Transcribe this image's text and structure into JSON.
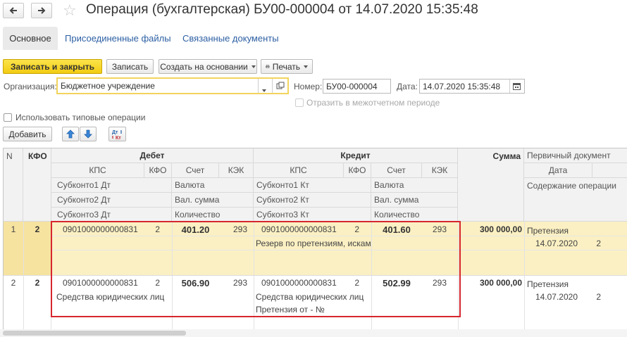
{
  "window": {
    "title": "Операция (бухгалтерская) БУ00-000004 от 14.07.2020 15:35:48"
  },
  "tabs": {
    "main": "Основное",
    "files": "Присоединенные файлы",
    "linked": "Связанные документы"
  },
  "toolbar": {
    "save_close": "Записать и закрыть",
    "save": "Записать",
    "create_based": "Создать на основании",
    "print": "Печать"
  },
  "form": {
    "org_label": "Организация:",
    "org_value": "Бюджетное учреждение",
    "number_label": "Номер:",
    "number_value": "БУ00-000004",
    "date_label": "Дата:",
    "date_value": "14.07.2020 15:35:48",
    "interperiod_label": "Отразить в межотчетном периоде",
    "typical_ops_label": "Использовать типовые операции",
    "add_button": "Добавить"
  },
  "table": {
    "headers": {
      "n": "N",
      "kfo": "КФО",
      "debit": "Дебет",
      "credit": "Кредит",
      "sum": "Сумма",
      "primary_doc": "Первичный документ",
      "kps": "КПС",
      "kfo_sub": "КФО",
      "account": "Счет",
      "kek": "КЭК",
      "date": "Дата",
      "sub1_dt": "Субконто1 Дт",
      "sub2_dt": "Субконто2 Дт",
      "sub3_dt": "Субконто3 Дт",
      "currency": "Валюта",
      "cur_sum": "Вал. сумма",
      "qty": "Количество",
      "sub1_kt": "Субконто1 Кт",
      "sub2_kt": "Субконто2 Кт",
      "sub3_kt": "Субконто3 Кт",
      "content": "Содержание операции"
    },
    "rows": [
      {
        "n": "1",
        "kfo": "2",
        "dt_kps": "0901000000000831",
        "dt_kfo": "2",
        "dt_account": "401.20",
        "dt_kek": "293",
        "dt_sub1": "",
        "dt_sub2": "",
        "kt_kps": "0901000000000831",
        "kt_kfo": "2",
        "kt_account": "401.60",
        "kt_kek": "293",
        "kt_sub1": "Резерв по претензиям, искам",
        "kt_sub2": "",
        "sum": "300 000,00",
        "doc_name": "Претензия",
        "doc_date": "14.07.2020",
        "doc_num": "2"
      },
      {
        "n": "2",
        "kfo": "2",
        "dt_kps": "0901000000000831",
        "dt_kfo": "2",
        "dt_account": "506.90",
        "dt_kek": "293",
        "dt_sub1": "Средства юридических лиц",
        "dt_sub2": "",
        "kt_kps": "0901000000000831",
        "kt_kfo": "2",
        "kt_account": "502.99",
        "kt_kek": "293",
        "kt_sub1": "Средства юридических лиц",
        "kt_sub2": "Претензия от - №",
        "sum": "300 000,00",
        "doc_name": "Претензия",
        "doc_date": "14.07.2020",
        "doc_num": "2"
      }
    ]
  },
  "colors": {
    "primary_button": "#f2cc12",
    "selected_row": "#fbf0c3",
    "highlight_frame": "#d6262e",
    "link": "#2c5fa3"
  }
}
